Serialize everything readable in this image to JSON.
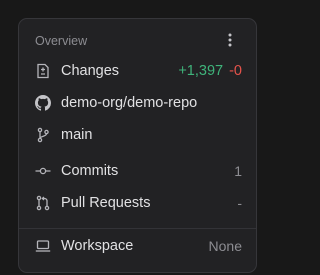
{
  "panel": {
    "header": "Overview",
    "menu_icon": "more-vertical-icon"
  },
  "rows": {
    "changes": {
      "icon": "file-diff-icon",
      "label": "Changes",
      "additions": "+1,397",
      "deletions": "-0"
    },
    "repo": {
      "icon": "github-icon",
      "label": "demo-org/demo-repo"
    },
    "branch": {
      "icon": "git-branch-icon",
      "label": "main"
    },
    "commits": {
      "icon": "git-commit-icon",
      "label": "Commits",
      "value": "1"
    },
    "pull_requests": {
      "icon": "git-pull-request-icon",
      "label": "Pull Requests",
      "value": "-"
    },
    "workspace": {
      "icon": "laptop-icon",
      "label": "Workspace",
      "value": "None"
    }
  },
  "colors": {
    "additions": "#3fb37a",
    "deletions": "#e5534b",
    "muted": "#8d8d92",
    "text": "#e1e1e3",
    "panel_bg": "#222224"
  }
}
